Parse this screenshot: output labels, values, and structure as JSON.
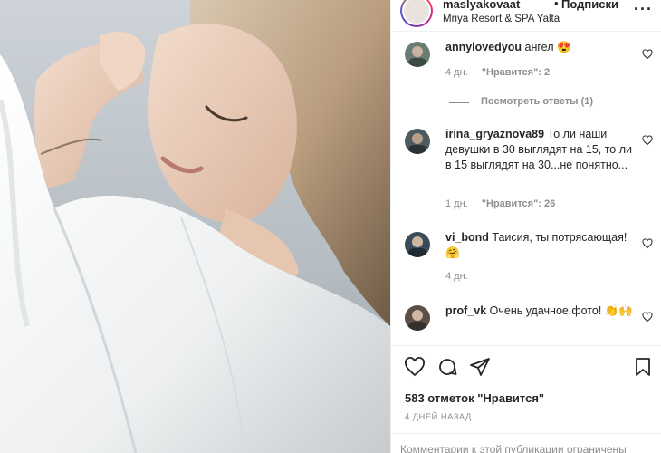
{
  "post": {
    "username": "maslyakovaat",
    "separator": "•",
    "follow_label": "Подписки",
    "location": "Mriya Resort & SPA Yalta",
    "more_icon": "more-icon"
  },
  "comments": [
    {
      "username": "annylovedyou",
      "text": "ангел 😍",
      "time": "4 дн.",
      "likes": "\"Нравится\": 2",
      "avatar_color": "#6b7c74"
    },
    {
      "username": "irina_gryaznova89",
      "text": "То ли наши девушки в 30 выглядят на 15, то ли в 15 выглядят на 30...не понятно...",
      "time": "1 дн.",
      "likes": "\"Нравится\": 26",
      "avatar_color": "#4d5a60"
    },
    {
      "username": "vi_bond",
      "text": "Таисия, ты потрясающая! 🤗",
      "time": "4 дн.",
      "likes": "",
      "avatar_color": "#3a4b5a"
    },
    {
      "username": "prof_vk",
      "text": "Очень удачное фото! 👏🙌",
      "time": "",
      "likes": "",
      "avatar_color": "#5b4f47"
    }
  ],
  "replies_label": "Посмотреть ответы (1)",
  "likes_count": "583 отметок \"Нравится\"",
  "timestamp": "4 ДНЕЙ НАЗАД",
  "comments_disabled": "Комментарии к этой публикации ограничены",
  "icons": [
    "heart-icon",
    "comment-icon",
    "share-icon",
    "bookmark-icon"
  ]
}
